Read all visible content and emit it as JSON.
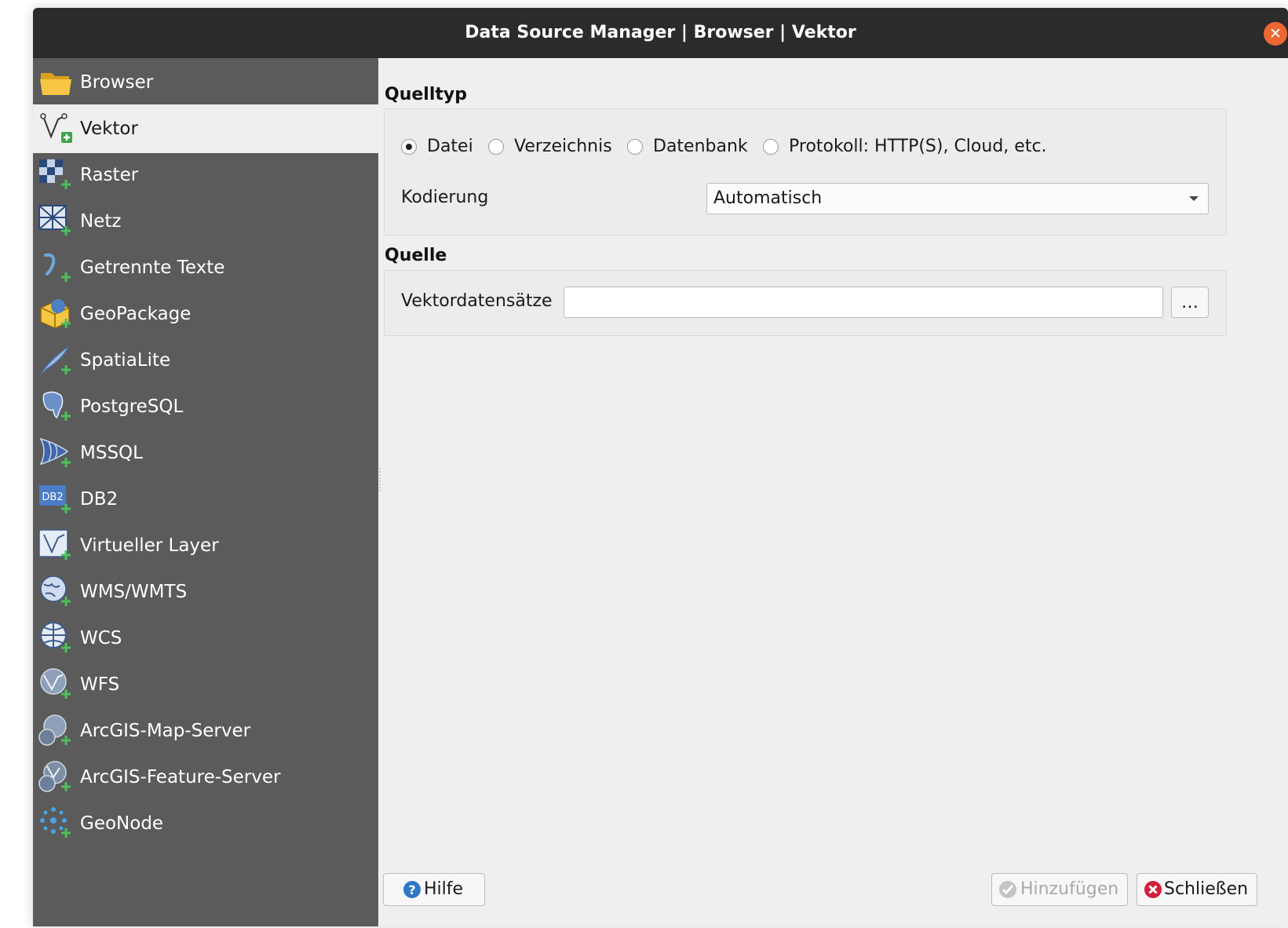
{
  "window": {
    "title": "Data Source Manager | Browser | Vektor",
    "close_icon": "close-icon"
  },
  "sidebar": {
    "items": [
      {
        "label": "Browser",
        "icon": "folder-icon",
        "selected": false
      },
      {
        "label": "Vektor",
        "icon": "vector-layer-icon",
        "selected": true
      },
      {
        "label": "Raster",
        "icon": "raster-layer-icon",
        "selected": false
      },
      {
        "label": "Netz",
        "icon": "mesh-layer-icon",
        "selected": false
      },
      {
        "label": "Getrennte Texte",
        "icon": "delimited-text-icon",
        "selected": false
      },
      {
        "label": "GeoPackage",
        "icon": "geopackage-icon",
        "selected": false
      },
      {
        "label": "SpatiaLite",
        "icon": "spatialite-icon",
        "selected": false
      },
      {
        "label": "PostgreSQL",
        "icon": "postgresql-icon",
        "selected": false
      },
      {
        "label": "MSSQL",
        "icon": "mssql-icon",
        "selected": false
      },
      {
        "label": "DB2",
        "icon": "db2-icon",
        "selected": false
      },
      {
        "label": "Virtueller Layer",
        "icon": "virtual-layer-icon",
        "selected": false
      },
      {
        "label": "WMS/WMTS",
        "icon": "wms-icon",
        "selected": false
      },
      {
        "label": "WCS",
        "icon": "wcs-icon",
        "selected": false
      },
      {
        "label": "WFS",
        "icon": "wfs-icon",
        "selected": false
      },
      {
        "label": "ArcGIS-Map-Server",
        "icon": "arcgis-map-server-icon",
        "selected": false
      },
      {
        "label": "ArcGIS-Feature-Server",
        "icon": "arcgis-feature-server-icon",
        "selected": false
      },
      {
        "label": "GeoNode",
        "icon": "geonode-icon",
        "selected": false
      }
    ]
  },
  "source_type": {
    "title": "Quelltyp",
    "options": [
      {
        "label": "Datei",
        "checked": true
      },
      {
        "label": "Verzeichnis",
        "checked": false
      },
      {
        "label": "Datenbank",
        "checked": false
      },
      {
        "label": "Protokoll: HTTP(S), Cloud, etc.",
        "checked": false
      }
    ],
    "encoding_label": "Kodierung",
    "encoding_value": "Automatisch"
  },
  "source": {
    "title": "Quelle",
    "datasets_label": "Vektordatensätze",
    "datasets_value": "",
    "browse_label": "…"
  },
  "buttons": {
    "help": "Hilfe",
    "add": "Hinzufügen",
    "close": "Schließen"
  },
  "colors": {
    "titlebar": "#2b2b2b",
    "sidebar": "#5b5b5b",
    "close_accent": "#ee6733",
    "help_blue": "#2f78c8",
    "close_red": "#d21f3c"
  }
}
